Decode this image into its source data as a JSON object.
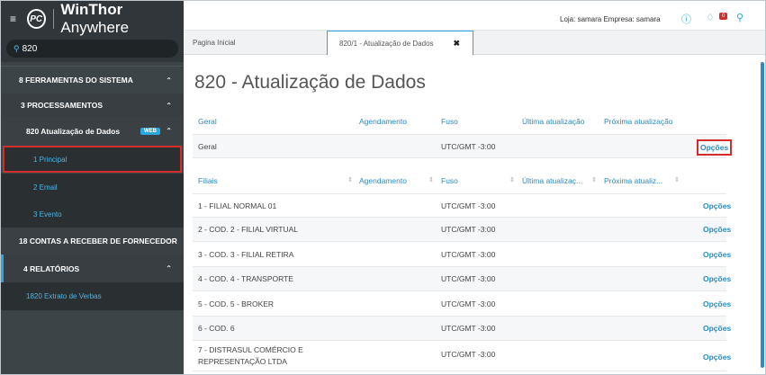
{
  "brand": {
    "logo": "PC",
    "name_bold": "WinThor",
    "name_rest": " Anywhere"
  },
  "search": {
    "value": "820"
  },
  "sidebar": {
    "ferramentas": "8  FERRAMENTAS DO SISTEMA",
    "processamentos": "3  PROCESSAMENTOS",
    "atualizacao": "820  Atualização de Dados",
    "web_badge": "WEB",
    "principal": "1  Principal",
    "email": "2  Email",
    "evento": "3  Evento",
    "contas": "18  CONTAS A RECEBER DE FORNECEDOR",
    "relatorios": "4  RELATÓRIOS",
    "extrato": "1820  Extrato de Verbas"
  },
  "topbar": {
    "loja": "Loja: samara   Empresa: samara",
    "bell_count": "0"
  },
  "tabs": {
    "home": "Pagina Inicial",
    "active": "820/1 - Atualização de Dados",
    "close": "✖"
  },
  "page": {
    "title": "820 - Atualização de Dados"
  },
  "geral_header": {
    "c1": "Geral",
    "c2": "Agendamento",
    "c3": "Fuso",
    "c4": "Última atualização",
    "c5": "Próxima atualização"
  },
  "geral_row": {
    "name": "Geral",
    "fuso": "UTC/GMT -3:00",
    "opcoes": "Opções"
  },
  "filiais_header": {
    "c1": "Filiais",
    "c2": "Agendamento",
    "c3": "Fuso",
    "c4": "Última atualizaç...",
    "c5": "Próxima atualiz..."
  },
  "filiais": [
    {
      "name": "1 - FILIAL NORMAL 01",
      "fuso": "UTC/GMT -3:00",
      "opcoes": "Opções"
    },
    {
      "name": "2 - COD. 2 - FILIAL VIRTUAL",
      "fuso": "UTC/GMT -3:00",
      "opcoes": "Opções"
    },
    {
      "name": "3 - COD. 3 - FILIAL RETIRA",
      "fuso": "UTC/GMT -3:00",
      "opcoes": "Opções"
    },
    {
      "name": "4 - COD. 4 - TRANSPORTE",
      "fuso": "UTC/GMT -3:00",
      "opcoes": "Opções"
    },
    {
      "name": "5 - COD. 5 - BROKER",
      "fuso": "UTC/GMT -3:00",
      "opcoes": "Opções"
    },
    {
      "name": "6 - COD. 6",
      "fuso": "UTC/GMT -3:00",
      "opcoes": "Opções"
    },
    {
      "name_line1": "7 - DISTRASUL COMÉRCIO E",
      "name_line2": "REPRESENTAÇÃO LTDA",
      "fuso": "UTC/GMT -3:00",
      "opcoes": "Opções"
    }
  ]
}
